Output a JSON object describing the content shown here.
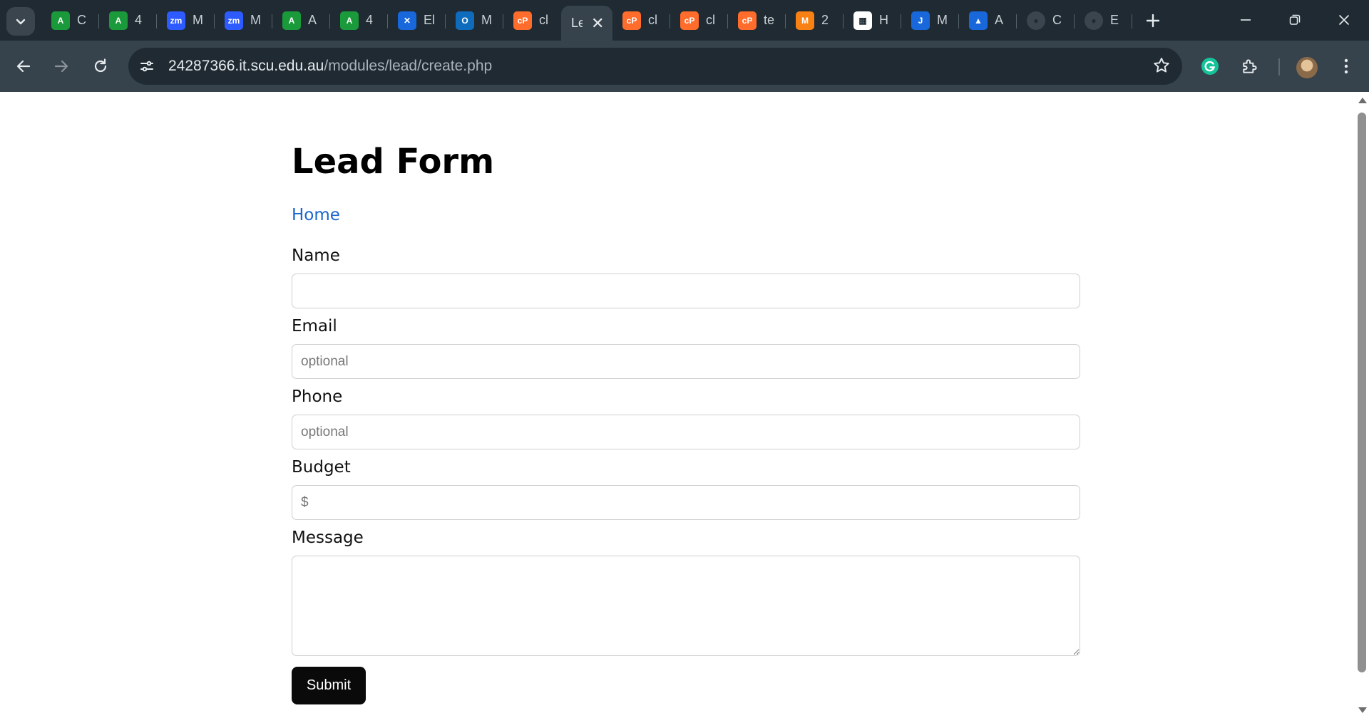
{
  "browser": {
    "tabs": [
      {
        "label": "C",
        "icon": "brand-a-icon",
        "color": "#1a9a3a"
      },
      {
        "label": "4",
        "icon": "brand-a-icon",
        "color": "#1a9a3a"
      },
      {
        "label": "M",
        "icon": "zoom-icon",
        "color": "#2d5bff",
        "favtext": "zm"
      },
      {
        "label": "M",
        "icon": "zoom-icon",
        "color": "#2d5bff",
        "favtext": "zm"
      },
      {
        "label": "A",
        "icon": "brand-a-icon",
        "color": "#1a9a3a"
      },
      {
        "label": "4",
        "icon": "brand-a-icon",
        "color": "#1a9a3a"
      },
      {
        "label": "El",
        "icon": "confluence-icon",
        "color": "#1868db"
      },
      {
        "label": "M",
        "icon": "outlook-icon",
        "color": "#0f6cbd"
      },
      {
        "label": "cl",
        "icon": "cpanel-icon",
        "color": "#ff6c2c",
        "favtext": "cP"
      },
      {
        "label": "Le",
        "icon": "",
        "color": "",
        "active": true
      },
      {
        "label": "cl",
        "icon": "cpanel-icon",
        "color": "#ff6c2c",
        "favtext": "cP"
      },
      {
        "label": "cl",
        "icon": "cpanel-icon",
        "color": "#ff6c2c",
        "favtext": "cP"
      },
      {
        "label": "te",
        "icon": "cpanel-icon",
        "color": "#ff6c2c",
        "favtext": "cP"
      },
      {
        "label": "2",
        "icon": "moodle-icon",
        "color": "#f98012"
      },
      {
        "label": "H",
        "icon": "grid-app-icon",
        "color": "#ffffff"
      },
      {
        "label": "M",
        "icon": "jira-icon",
        "color": "#1868db"
      },
      {
        "label": "A",
        "icon": "atlassian-icon",
        "color": "#1868db"
      },
      {
        "label": "C",
        "icon": "github-icon",
        "color": "#24292e"
      },
      {
        "label": "E",
        "icon": "github-icon",
        "color": "#24292e"
      }
    ],
    "url_host": "24287366.it.scu.edu.au",
    "url_path": "/modules/lead/create.php"
  },
  "page": {
    "title": "Lead Form",
    "home_link": "Home",
    "fields": {
      "name": {
        "label": "Name",
        "placeholder": ""
      },
      "email": {
        "label": "Email",
        "placeholder": "optional"
      },
      "phone": {
        "label": "Phone",
        "placeholder": "optional"
      },
      "budget": {
        "label": "Budget",
        "placeholder": "$"
      },
      "message": {
        "label": "Message",
        "placeholder": ""
      }
    },
    "submit_label": "Submit"
  },
  "colors": {
    "link": "#1a66cc",
    "submit_bg": "#0a0a0a",
    "titlebar_bg": "#1f2a32",
    "toolbar_bg": "#37434c"
  }
}
